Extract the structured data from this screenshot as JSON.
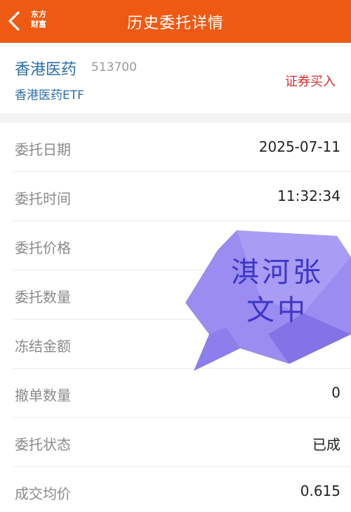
{
  "header": {
    "back_icon": "chevron-left-icon",
    "logo_line1": "东方",
    "logo_line2": "财富",
    "title": "历史委托详情"
  },
  "stock": {
    "name": "香港医药",
    "code": "513700",
    "full_name": "香港医药ETF",
    "trade_type": "证券买入"
  },
  "rows": [
    {
      "label": "委托日期",
      "value": "2025-07-11"
    },
    {
      "label": "委托时间",
      "value": "11:32:34"
    },
    {
      "label": "委托价格",
      "value": ""
    },
    {
      "label": "委托数量",
      "value": ""
    },
    {
      "label": "冻结金额",
      "value": ""
    },
    {
      "label": "撤单数量",
      "value": "0"
    },
    {
      "label": "委托状态",
      "value": "已成"
    },
    {
      "label": "成交均价",
      "value": "0.615"
    }
  ],
  "watermark": {
    "line1": "淇河张",
    "line2": "文中"
  },
  "colors": {
    "header_bg": "#ee5a14",
    "stock_blue": "#2c6fa8",
    "trade_red": "#d0312d",
    "watermark_purple": "#8f80ee"
  }
}
